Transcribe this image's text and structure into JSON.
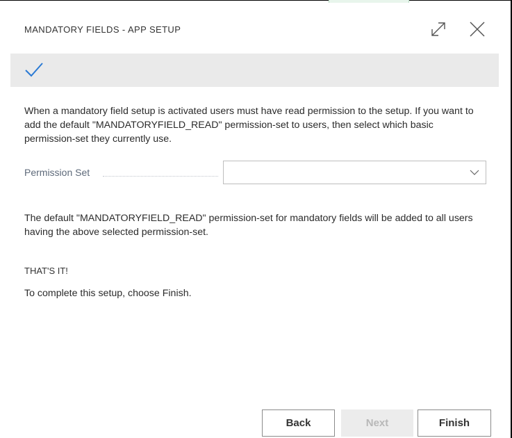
{
  "dialog": {
    "title": "MANDATORY FIELDS - APP SETUP"
  },
  "banner": {
    "icon": "checkmark-icon",
    "accent_color": "#2a7ad4"
  },
  "intro_text": "When a mandatory field setup is activated users must have read permission to the setup. If you want to add the default \"MANDATORYFIELD_READ\" permission-set to users, then select which basic permission-set they currently use.",
  "permission_field": {
    "label": "Permission Set",
    "value": ""
  },
  "info_text": "The default \"MANDATORYFIELD_READ\" permission-set for mandatory fields will be added to all users having the above selected permission-set.",
  "completion": {
    "heading": "THAT'S IT!",
    "text": "To complete this setup, choose Finish."
  },
  "buttons": {
    "back": "Back",
    "next": "Next",
    "finish": "Finish",
    "next_enabled": false
  }
}
